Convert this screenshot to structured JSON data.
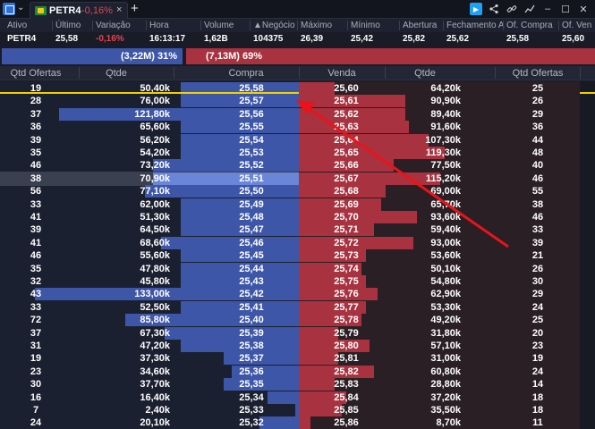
{
  "tab": {
    "ticker": "PETR4",
    "change": "-0,16%",
    "close": "×",
    "add": "+"
  },
  "quote": {
    "headers": [
      "Ativo",
      "Último",
      "Variação",
      "Hora",
      "Volume",
      "▲Negócio",
      "Máximo",
      "Mínimo",
      "Abertura",
      "Fechamento A",
      "Of. Compra",
      "Of. Ven"
    ],
    "values": [
      "PETR4",
      "25,58",
      "-0,16%",
      "16:13:17",
      "1,62B",
      "104375",
      "26,39",
      "25,42",
      "25,82",
      "25,62",
      "25,58",
      "25,60"
    ]
  },
  "pressure": {
    "buy_label": "(3,22M) 31%",
    "sell_label": "(7,13M) 69%",
    "buy_pct": 31,
    "sell_pct": 69
  },
  "book": {
    "headers": [
      "Qtd Ofertas",
      "Qtde",
      "Compra",
      "Venda",
      "Qtde",
      "Qtd Ofertas"
    ],
    "selected_row": 6,
    "rows": [
      {
        "bo": "19",
        "bq": "50,40k",
        "bp": "25,58",
        "sp": "25,60",
        "sq": "64,20k",
        "so": "25",
        "bb": 0.3,
        "sb": 0.09
      },
      {
        "bo": "28",
        "bq": "76,00k",
        "bp": "25,57",
        "sp": "25,61",
        "sq": "90,90k",
        "so": "26",
        "bb": 0.3,
        "sb": 0.27
      },
      {
        "bo": "37",
        "bq": "121,80k",
        "bp": "25,56",
        "sp": "25,62",
        "sq": "89,40k",
        "so": "29",
        "bb": 0.61,
        "sb": 0.27
      },
      {
        "bo": "36",
        "bq": "65,60k",
        "bp": "25,55",
        "sp": "25,63",
        "sq": "91,60k",
        "so": "36",
        "bb": 0.3,
        "sb": 0.28
      },
      {
        "bo": "39",
        "bq": "56,20k",
        "bp": "25,54",
        "sp": "25,64",
        "sq": "107,30k",
        "so": "44",
        "bb": 0.3,
        "sb": 0.33
      },
      {
        "bo": "35",
        "bq": "54,20k",
        "bp": "25,53",
        "sp": "25,65",
        "sq": "119,30k",
        "so": "48",
        "bb": 0.3,
        "sb": 0.37
      },
      {
        "bo": "46",
        "bq": "73,20k",
        "bp": "25,52",
        "sp": "25,66",
        "sq": "77,50k",
        "so": "40",
        "bb": 0.37,
        "sb": 0.24
      },
      {
        "bo": "38",
        "bq": "70,90k",
        "bp": "25,51",
        "sp": "25,67",
        "sq": "115,20k",
        "so": "46",
        "bb": 0.37,
        "sb": 0.36
      },
      {
        "bo": "56",
        "bq": "77,10k",
        "bp": "25,50",
        "sp": "25,68",
        "sq": "69,00k",
        "so": "55",
        "bb": 0.39,
        "sb": 0.22
      },
      {
        "bo": "33",
        "bq": "62,00k",
        "bp": "25,49",
        "sp": "25,69",
        "sq": "65,70k",
        "so": "38",
        "bb": 0.3,
        "sb": 0.21
      },
      {
        "bo": "41",
        "bq": "51,30k",
        "bp": "25,48",
        "sp": "25,70",
        "sq": "93,60k",
        "so": "46",
        "bb": 0.3,
        "sb": 0.3
      },
      {
        "bo": "39",
        "bq": "64,50k",
        "bp": "25,47",
        "sp": "25,71",
        "sq": "59,40k",
        "so": "33",
        "bb": 0.3,
        "sb": 0.19
      },
      {
        "bo": "41",
        "bq": "68,60k",
        "bp": "25,46",
        "sp": "25,72",
        "sq": "93,00k",
        "so": "39",
        "bb": 0.35,
        "sb": 0.29
      },
      {
        "bo": "46",
        "bq": "55,60k",
        "bp": "25,45",
        "sp": "25,73",
        "sq": "53,60k",
        "so": "21",
        "bb": 0.3,
        "sb": 0.17
      },
      {
        "bo": "35",
        "bq": "47,80k",
        "bp": "25,44",
        "sp": "25,74",
        "sq": "50,10k",
        "so": "26",
        "bb": 0.3,
        "sb": 0.16
      },
      {
        "bo": "32",
        "bq": "45,80k",
        "bp": "25,43",
        "sp": "25,75",
        "sq": "54,80k",
        "so": "30",
        "bb": 0.3,
        "sb": 0.17
      },
      {
        "bo": "43",
        "bq": "133,00k",
        "bp": "25,42",
        "sp": "25,76",
        "sq": "62,90k",
        "so": "29",
        "bb": 0.67,
        "sb": 0.2
      },
      {
        "bo": "33",
        "bq": "52,50k",
        "bp": "25,41",
        "sp": "25,77",
        "sq": "53,30k",
        "so": "24",
        "bb": 0.3,
        "sb": 0.17
      },
      {
        "bo": "72",
        "bq": "85,80k",
        "bp": "25,40",
        "sp": "25,78",
        "sq": "49,20k",
        "so": "25",
        "bb": 0.44,
        "sb": 0.16
      },
      {
        "bo": "37",
        "bq": "67,30k",
        "bp": "25,39",
        "sp": "25,79",
        "sq": "31,80k",
        "so": "20",
        "bb": 0.34,
        "sb": 0.1
      },
      {
        "bo": "31",
        "bq": "47,20k",
        "bp": "25,38",
        "sp": "25,80",
        "sq": "57,10k",
        "so": "23",
        "bb": 0.3,
        "sb": 0.18
      },
      {
        "bo": "19",
        "bq": "37,30k",
        "bp": "25,37",
        "sp": "25,81",
        "sq": "31,00k",
        "so": "19",
        "bb": 0.19,
        "sb": 0.1
      },
      {
        "bo": "23",
        "bq": "34,60k",
        "bp": "25,36",
        "sp": "25,82",
        "sq": "60,80k",
        "so": "24",
        "bb": 0.17,
        "sb": 0.19
      },
      {
        "bo": "30",
        "bq": "37,70k",
        "bp": "25,35",
        "sp": "25,83",
        "sq": "28,80k",
        "so": "14",
        "bb": 0.19,
        "sb": 0.09
      },
      {
        "bo": "16",
        "bq": "16,40k",
        "bp": "25,34",
        "sp": "25,84",
        "sq": "37,20k",
        "so": "18",
        "bb": 0.08,
        "sb": 0.12
      },
      {
        "bo": "7",
        "bq": "2,40k",
        "bp": "25,33",
        "sp": "25,85",
        "sq": "35,50k",
        "so": "18",
        "bb": 0.01,
        "sb": 0.11
      },
      {
        "bo": "24",
        "bq": "20,10k",
        "bp": "25,32",
        "sp": "25,86",
        "sq": "8,70k",
        "so": "11",
        "bb": 0.1,
        "sb": 0.03
      }
    ]
  },
  "colors": {
    "buy": "#3d56a8",
    "sell": "#a8323f",
    "last_marker": "#f0d000",
    "annotation_arrow": "#e8141c"
  },
  "icons": [
    "app-logo-icon",
    "chevron-down-icon",
    "play-icon",
    "share-icon",
    "link-icon",
    "chart-icon",
    "minimize-icon",
    "maximize-icon",
    "close-icon"
  ]
}
